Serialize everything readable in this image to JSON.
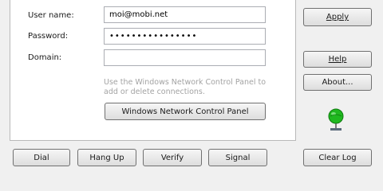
{
  "form": {
    "username_label": "User name:",
    "username_value": "moi@mobi.net",
    "password_label": "Password:",
    "password_value": "••••••••••••••••",
    "domain_label": "Domain:",
    "domain_value": "",
    "hint_text": "Use the Windows Network Control Panel to add or delete connections.",
    "network_panel_button": "Windows Network Control Panel"
  },
  "side": {
    "apply": "Apply",
    "help": "Help",
    "about": "About..."
  },
  "bottom": {
    "dial": "Dial",
    "hangup": "Hang Up",
    "verify": "Verify",
    "signal": "Signal",
    "clearlog": "Clear Log"
  },
  "icons": {
    "status": "network-globe-icon"
  },
  "colors": {
    "globe_green": "#1fb81f",
    "panel_bg": "#ffffff",
    "window_bg": "#f0f0f0"
  }
}
